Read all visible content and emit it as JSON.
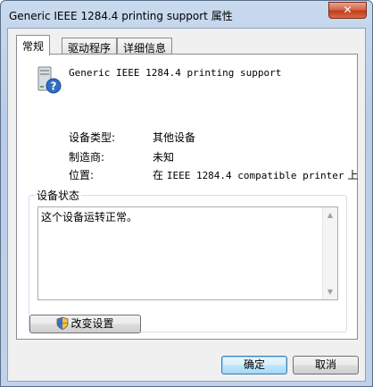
{
  "window": {
    "title": "Generic IEEE 1284.4 printing support 属性",
    "close_label": "✕"
  },
  "tabs": [
    {
      "label": "常规",
      "active": true
    },
    {
      "label": "驱动程序",
      "active": false
    },
    {
      "label": "详细信息",
      "active": false
    }
  ],
  "device": {
    "name": "Generic IEEE 1284.4 printing support",
    "icon": "printer-unknown-device-icon"
  },
  "properties": [
    {
      "label": "设备类型:",
      "value": "其他设备"
    },
    {
      "label": "制造商:",
      "value": "未知"
    },
    {
      "label": "位置:",
      "value_prefix": "在 ",
      "value_mono": "IEEE 1284.4 compatible printer",
      "value_suffix": " 上"
    }
  ],
  "status_group": {
    "label": "设备状态",
    "text": "这个设备运转正常。"
  },
  "buttons": {
    "change_settings": "改变设置",
    "ok": "确定",
    "cancel": "取消"
  },
  "colors": {
    "accent": "#3c7fb1",
    "close": "#c03a18"
  }
}
